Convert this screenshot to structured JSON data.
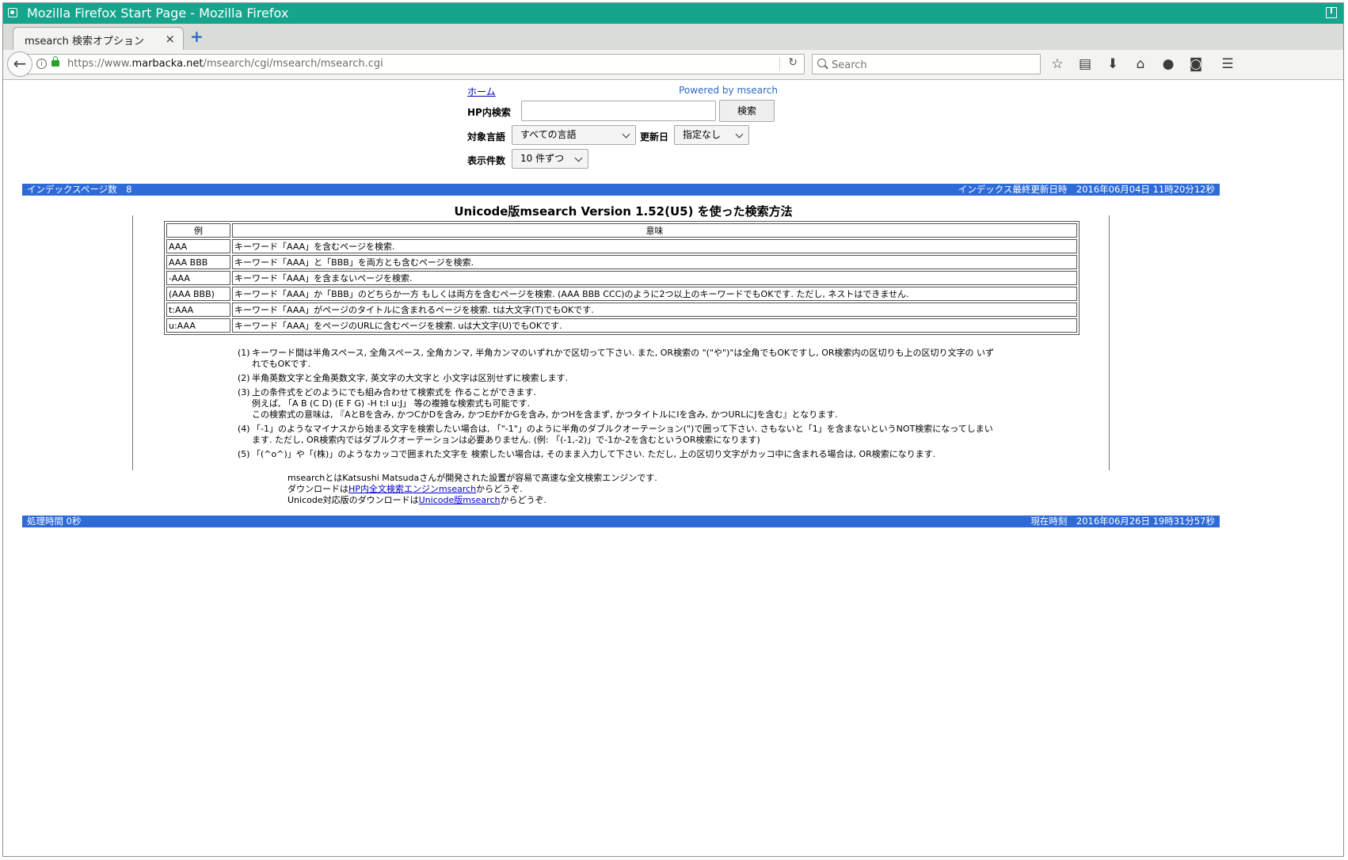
{
  "window": {
    "title": "Mozilla Firefox Start Page - Mozilla Firefox"
  },
  "tab": {
    "label": "msearch 検索オプション",
    "close": "×",
    "new_tab": "+"
  },
  "nav": {
    "url_prefix": "https://www.",
    "url_host": "marbacka.net",
    "url_path": "/msearch/cgi/msearch/msearch.cgi",
    "search_placeholder": "Search"
  },
  "form": {
    "home_link": "ホーム",
    "powered_by": "Powered by msearch",
    "query_label": "HP内検索",
    "search_button": "検索",
    "language_label": "対象言語",
    "language_value": "すべての言語",
    "updated_label": "更新日",
    "updated_value": "指定なし",
    "count_label": "表示件数",
    "count_value": "10 件ずつ"
  },
  "index_bar": {
    "left": "インデックスページ数　8",
    "right": "インデックス最終更新日時　2016年06月04日 11時20分12秒"
  },
  "heading": "Unicode版msearch  Version 1.52(U5) を使った検索方法",
  "table": {
    "headers": [
      "例",
      "意味"
    ],
    "rows": [
      [
        "AAA",
        "キーワード「AAA」を含むページを検索."
      ],
      [
        "AAA BBB",
        "キーワード「AAA」と「BBB」を両方とも含むページを検索."
      ],
      [
        "-AAA",
        "キーワード「AAA」を含まないページを検索."
      ],
      [
        "(AAA BBB)",
        "キーワード「AAA」か「BBB」のどちらか一方 もしくは両方を含むページを検索. (AAA BBB CCC)のように2つ以上のキーワードでもOKです.  ただし, ネストはできません."
      ],
      [
        "t:AAA",
        "キーワード「AAA」がページのタイトルに含まれるページを検索.  tは大文字(T)でもOKです."
      ],
      [
        "u:AAA",
        "キーワード「AAA」をページのURLに含むページを検索.  uは大文字(U)でもOKです."
      ]
    ]
  },
  "notes": [
    {
      "num": "(1)",
      "text": "キーワード間は半角スペース, 全角スペース,  全角カンマ, 半角カンマのいずれかで区切って下さい. また, OR検索の \"(\"や\")\"は全角でもOKですし, OR検索内の区切りも上の区切り文字の いずれでもOKです."
    },
    {
      "num": "(2)",
      "text": "半角英数文字と全角英数文字, 英文字の大文字と 小文字は区別せずに検索します."
    },
    {
      "num": "(3)",
      "line1": "上の条件式をどのようにでも組み合わせて検索式を 作ることができます.",
      "line2": "例えば, 「A B (C D) (E F G) -H t:I u:J」 等の複雑な検索式も可能です.",
      "line3": "この検索式の意味は, 『AとBを含み,  かつCかDを含み, かつEかFかGを含み, かつHを含まず,  かつタイトルにIを含み, かつURLにJを含む』となります."
    },
    {
      "num": "(4)",
      "text": "「-1」のようなマイナスから始まる文字を検索したい場合は,  「\"-1\"」のように半角のダブルクオーテーション(\")で囲って下さい.  さもないと「1」を含まないというNOT検索になってしまいます.  ただし, OR検索内ではダブルクオーテーションは必要ありません.  (例: 「(-1,-2)」で-1か-2を含むというOR検索になります)"
    },
    {
      "num": "(5)",
      "text": "「(^o^)」や「(株)」のようなカッコで囲まれた文字を 検索したい場合は, そのまま入力して下さい. ただし,  上の区切り文字がカッコ中に含まれる場合は, OR検索になります."
    }
  ],
  "about": {
    "line1": "msearchとはKatsushi Matsudaさんが開発された設置が容易で高速な全文検索エンジンです.",
    "line2_prefix": "ダウンロードは",
    "line2_link": "HP内全文検索エンジンmsearch",
    "line2_suffix": "からどうぞ.",
    "line3_prefix": "Unicode対応版のダウンロードは",
    "line3_link": "Unicode版msearch",
    "line3_suffix": "からどうぞ."
  },
  "footer_bar": {
    "left": "処理時間 0秒",
    "right": "現在時刻　2016年06月26日 19時31分57秒"
  },
  "colors": {
    "titlebar": "#15a58c",
    "bluebar": "#2e6bd9",
    "link": "#0000cc",
    "powered": "#2e6bc6"
  }
}
